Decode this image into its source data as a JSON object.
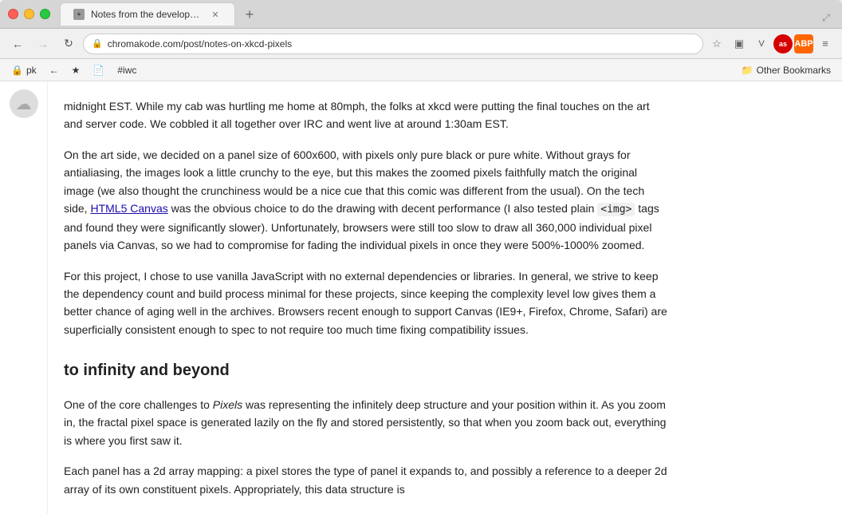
{
  "window": {
    "title": "Notes from the developme",
    "tab_label": "Notes from the developme"
  },
  "browser": {
    "url": "chromakode.com/post/notes-on-xkcd-pixels",
    "back_enabled": true,
    "forward_enabled": false
  },
  "bookmarks": {
    "items": [
      {
        "icon": "🔒",
        "label": "pk"
      },
      {
        "icon": "←",
        "label": ""
      },
      {
        "icon": "★",
        "label": ""
      },
      {
        "icon": "📄",
        "label": ""
      },
      {
        "label": "#iwc"
      }
    ],
    "right": "Other Bookmarks"
  },
  "article": {
    "section1_p1": "midnight EST. While my cab was hurtling me home at 80mph, the folks at xkcd were putting the final touches on the art and server code. We cobbled it all together over IRC and went live at around 1:30am EST.",
    "section1_p2_start": "On the art side, we decided on a panel size of 600x600, with pixels only pure black or pure white. Without grays for antialiasing, the images look a little crunchy to the eye, but this makes the zoomed pixels faithfully match the original image (we also thought the crunchiness would be a nice cue that this comic was different from the usual). On the tech side, ",
    "section1_link": "HTML5 Canvas",
    "section1_p2_mid": " was the obvious choice to do the drawing with decent performance (I also tested plain ",
    "section1_code": "<img>",
    "section1_p2_end": " tags and found they were significantly slower). Unfortunately, browsers were still too slow to draw all 360,000 individual pixel panels via Canvas, so we had to compromise for fading the individual pixels in once they were 500%-1000% zoomed.",
    "section1_p3": "For this project, I chose to use vanilla JavaScript with no external dependencies or libraries. In general, we strive to keep the dependency count and build process minimal for these projects, since keeping the complexity level low gives them a better chance of aging well in the archives. Browsers recent enough to support Canvas (IE9+, Firefox, Chrome, Safari) are superficially consistent enough to spec to not require too much time fixing compatibility issues.",
    "section2_heading": "to infinity and beyond",
    "section2_p1_start": "One of the core challenges to ",
    "section2_p1_italic": "Pixels",
    "section2_p1_end": " was representing the infinitely deep structure and your position within it. As you zoom in, the fractal pixel space is generated lazily on the fly and stored persistently, so that when you zoom back out, everything is where you first saw it.",
    "section2_p2": "Each panel has a 2d array mapping: a pixel stores the type of panel it expands to, and possibly a reference to a deeper 2d array of its own constituent pixels. Appropriately, this data structure is"
  },
  "toolbar_icons": {
    "back": "←",
    "forward": "→",
    "reload": "↻",
    "star": "☆",
    "menu": "≡",
    "extensions": "as"
  }
}
